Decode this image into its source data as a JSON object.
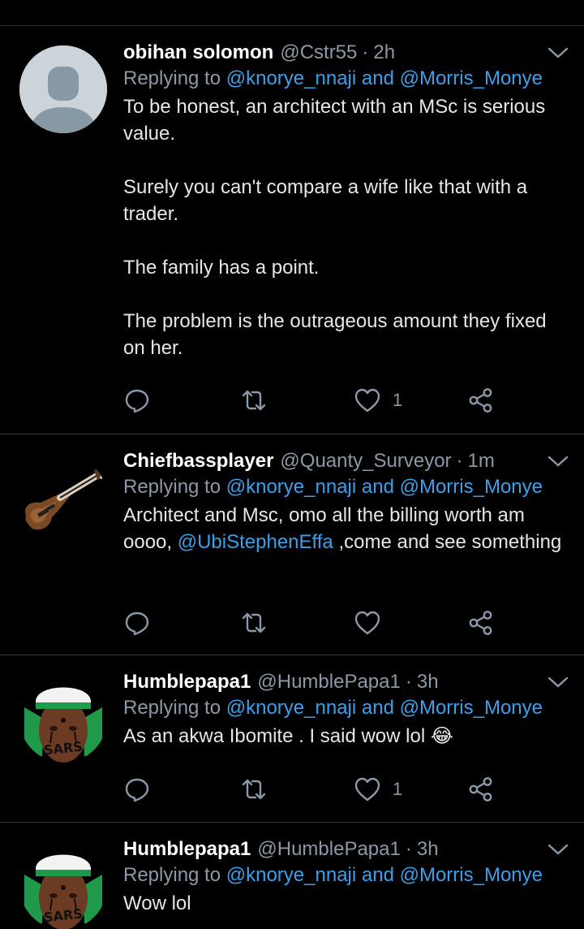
{
  "colors": {
    "background": "#000000",
    "link": "#3d9fe6",
    "muted": "#8b98a5",
    "text": "#e6e6e6",
    "divider": "#2f3336"
  },
  "tweets": [
    {
      "name": "obihan solomon",
      "handle": "@Cstr55",
      "dot": "·",
      "time": "2h",
      "reply_prefix": "Replying to",
      "reply_to_1": "@knorye_nnaji",
      "reply_and": "and",
      "reply_to_2": "@Morris_Monye",
      "paragraphs": [
        "To be honest, an architect with an MSc is serious value.",
        "Surely you can't compare a wife like that with a trader.",
        "The family has a point.",
        "The problem is the outrageous amount they fixed on her."
      ],
      "like_count": "1",
      "avatar_icon": "default-profile-icon"
    },
    {
      "name": "Chiefbassplayer",
      "handle": "@Quanty_Surveyor",
      "dot": "·",
      "time": "1m",
      "reply_prefix": "Replying to",
      "reply_to_1": "@knorye_nnaji",
      "reply_and": "and",
      "reply_to_2": "@Morris_Monye",
      "text_before": "Architect and Msc, omo all the billing worth am oooo, ",
      "mention": "@UbiStephenEffa",
      "text_after": " ,come and see something",
      "like_count": "",
      "avatar_icon": "bass-guitar-icon"
    },
    {
      "name": "Humblepapa1",
      "handle": "@HumblePapa1",
      "dot": "·",
      "time": "3h",
      "reply_prefix": "Replying to",
      "reply_to_1": "@knorye_nnaji",
      "reply_and": "and",
      "reply_to_2": "@Morris_Monye",
      "text": "As an akwa Ibomite . I said wow lol",
      "emoji": "😂",
      "like_count": "1",
      "avatar_icon": "endsars-portrait-icon"
    },
    {
      "name": "Humblepapa1",
      "handle": "@HumblePapa1",
      "dot": "·",
      "time": "3h",
      "reply_prefix": "Replying to",
      "reply_to_1": "@knorye_nnaji",
      "reply_and": "and",
      "reply_to_2": "@Morris_Monye",
      "text": "Wow lol",
      "avatar_icon": "endsars-portrait-icon"
    }
  ]
}
